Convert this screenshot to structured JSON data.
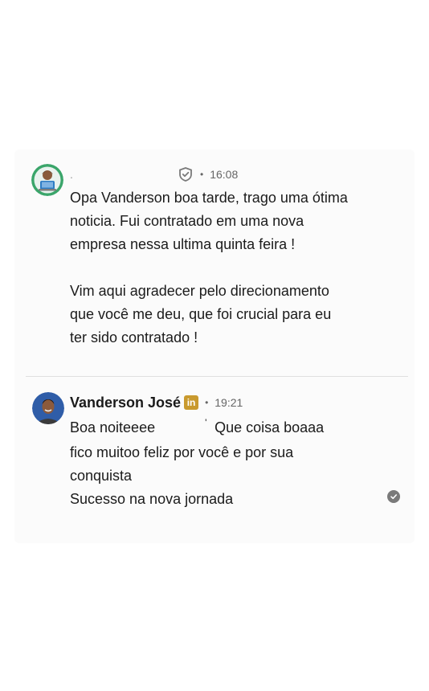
{
  "message1": {
    "sender_name": ".",
    "avatar_icon": "person-with-laptop-avatar",
    "badge_icon": "shield-check-icon",
    "separator": "•",
    "time": "16:08",
    "lines": [
      "Opa Vanderson boa tarde, trago uma ótima",
      "noticia. Fui contratado em uma nova",
      "empresa nessa ultima quinta feira !",
      "",
      "Vim aqui agradecer pelo direcionamento",
      "que você me deu, que foi crucial para eu",
      "ter sido contratado !"
    ]
  },
  "message2": {
    "sender_name": "Vanderson José",
    "avatar_icon": "profile-photo-avatar",
    "badge_icon": "linkedin-icon",
    "badge_text": "in",
    "separator": "•",
    "time": "19:21",
    "lines": [
      "Boa noiteeee",
      "fico muitoo feliz por você e por sua",
      "conquista",
      "Sucesso na nova jornada"
    ],
    "first_line_extra": "Que coisa boaaa",
    "first_line_mark": "'",
    "status_icon": "read-check-icon"
  },
  "colors": {
    "linkedin_badge": "#c99a2e",
    "divider": "#e0e0e0",
    "avatar1_ring": "#3aa56a"
  }
}
